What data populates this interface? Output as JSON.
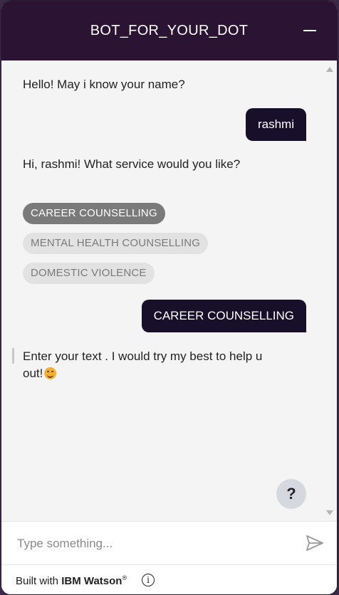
{
  "header": {
    "title": "BOT_FOR_YOUR_DOT",
    "minimize_icon": "minimize-icon"
  },
  "messages": [
    {
      "from": "bot",
      "text": "Hello! May i know your name?"
    },
    {
      "from": "user",
      "text": "rashmi"
    },
    {
      "from": "bot",
      "text": "Hi, rashmi! What service would you like?"
    },
    {
      "from": "user",
      "text": "CAREER COUNSELLING"
    },
    {
      "from": "bot",
      "text_line1": "Enter your text . I would try my best to help u",
      "text_line2": "out!",
      "emoji": "smiling-face-icon"
    }
  ],
  "options": [
    {
      "label": "CAREER COUNSELLING",
      "selected": true
    },
    {
      "label": "MENTAL HEALTH COUNSELLING",
      "selected": false
    },
    {
      "label": "DOMESTIC VIOLENCE",
      "selected": false
    }
  ],
  "help": {
    "label": "?"
  },
  "input": {
    "placeholder": "Type something...",
    "value": ""
  },
  "footer": {
    "built_with": "Built with",
    "brand": "IBM Watson",
    "registered": "®",
    "info_label": "i"
  },
  "colors": {
    "header_bg": "#2b1433",
    "user_bubble": "#180f2a",
    "chip_selected": "#7a7a7a",
    "chip_unselected": "#e2e2e2"
  }
}
